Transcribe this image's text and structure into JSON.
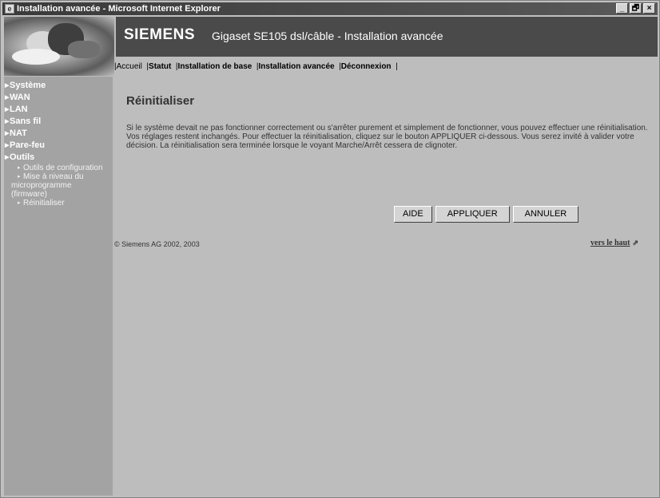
{
  "window": {
    "title": "Installation avancée - Microsoft Internet Explorer",
    "minimize_icon": "_",
    "maximize_icon": "🗗",
    "close_icon": "×"
  },
  "header": {
    "brand": "SIEMENS",
    "product": "Gigaset SE105 dsl/câble  -  Installation avancée",
    "nav": [
      "Accueil",
      "Statut",
      "Installation de base",
      "Installation avancée",
      "Déconnexion"
    ]
  },
  "sidebar": {
    "items": [
      "Système",
      "WAN",
      "LAN",
      "Sans fil",
      "NAT",
      "Pare-feu",
      "Outils"
    ],
    "subitems": [
      "Outils de configuration",
      "Mise à niveau du microprogramme (firmware)",
      "Réinitialiser"
    ]
  },
  "main": {
    "title": "Réinitialiser",
    "description": "Si le système devait ne pas fonctionner correctement ou s'arrêter purement et simplement de fonctionner, vous pouvez effectuer une réinitialisation. Vos réglages restent inchangés. Pour effectuer la réinitialisation, cliquez sur le bouton APPLIQUER ci-dessous. Vous serez invité à valider votre décision. La réinitialisation sera terminée lorsque le voyant Marche/Arrêt cessera de clignoter.",
    "buttons": {
      "help": "AIDE",
      "apply": "APPLIQUER",
      "cancel": "ANNULER"
    },
    "top_link": "vers le haut",
    "copyright": "© Siemens AG 2002, 2003"
  }
}
